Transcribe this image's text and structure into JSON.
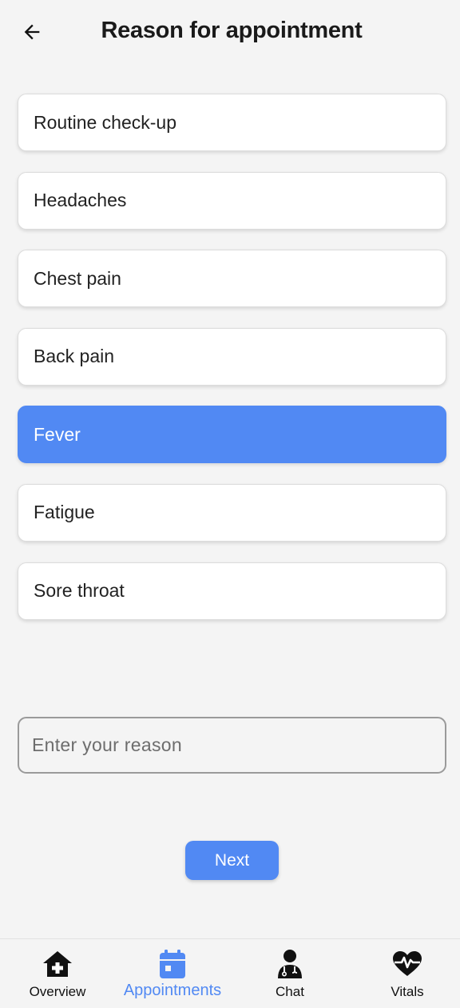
{
  "header": {
    "title": "Reason for appointment",
    "back_icon": "arrow-left-icon"
  },
  "reasons": [
    {
      "label": "Routine check-up",
      "selected": false
    },
    {
      "label": "Headaches",
      "selected": false
    },
    {
      "label": "Chest pain",
      "selected": false
    },
    {
      "label": "Back pain",
      "selected": false
    },
    {
      "label": "Fever",
      "selected": true
    },
    {
      "label": "Fatigue",
      "selected": false
    },
    {
      "label": "Sore throat",
      "selected": false
    }
  ],
  "custom_reason": {
    "placeholder": "Enter your reason",
    "value": ""
  },
  "next_button": {
    "label": "Next"
  },
  "bottom_nav": {
    "items": [
      {
        "label": "Overview",
        "icon": "home-medical-icon",
        "active": false
      },
      {
        "label": "Appointments",
        "icon": "calendar-icon",
        "active": true
      },
      {
        "label": "Chat",
        "icon": "doctor-icon",
        "active": false
      },
      {
        "label": "Vitals",
        "icon": "heartbeat-icon",
        "active": false
      }
    ]
  },
  "colors": {
    "accent": "#5189f3",
    "background": "#f4f4f4",
    "card": "#ffffff"
  }
}
